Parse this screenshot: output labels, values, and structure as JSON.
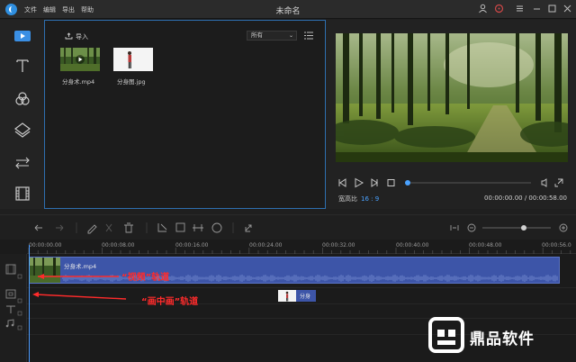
{
  "titlebar": {
    "menu": [
      "文件",
      "编辑",
      "导出",
      "帮助"
    ],
    "title": "未命名"
  },
  "library": {
    "import_label": "导入",
    "filter_value": "所有",
    "items": [
      {
        "name": "分身术.mp4",
        "type": "video"
      },
      {
        "name": "分身图.jpg",
        "type": "image"
      }
    ]
  },
  "preview": {
    "aspect_label": "宽高比",
    "aspect_value": "16 : 9",
    "timecode": "00:00:00.00 / 00:00:58.00",
    "progress": 0.0
  },
  "timeline": {
    "ticks": [
      "00:00:00.00",
      "00:00:08.00",
      "00:00:16.00",
      "00:00:24.00",
      "00:00:32.00",
      "00:00:40.00",
      "00:00:48.00",
      "00:00:56.0"
    ],
    "video_clip_name": "分身术.mp4",
    "pip_clip_name": "分身",
    "zoom_level": 0.6
  },
  "annotations": {
    "video_track": "“视频”轨道",
    "pip_track": "“画中画”轨道"
  },
  "watermark": {
    "text": "鼎品软件"
  },
  "colors": {
    "accent": "#3a8fe4",
    "clip": "#3d55a8",
    "annotation": "#ff2b2b"
  }
}
